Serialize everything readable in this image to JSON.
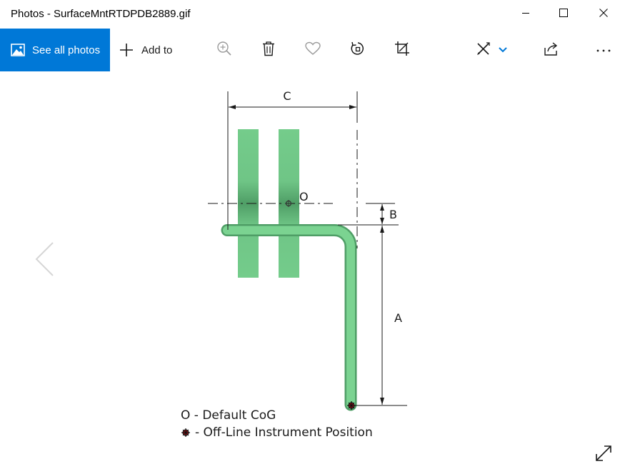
{
  "window": {
    "title": "Photos - SurfaceMntRTDPDB2889.gif",
    "controls": {
      "minimize_icon": "minimize-icon",
      "maximize_icon": "maximize-icon",
      "close_icon": "close-icon"
    }
  },
  "toolbar": {
    "see_all_label": "See all photos",
    "add_to_label": "Add to",
    "icons": [
      "zoom-in-icon",
      "delete-icon",
      "favorite-icon",
      "rotate-icon",
      "crop-icon",
      "edit-icon",
      "share-icon",
      "more-icon"
    ],
    "accent_color": "#0078d7"
  },
  "diagram": {
    "labels": {
      "c": "C",
      "b": "B",
      "a": "A",
      "o": "O"
    },
    "legend": {
      "default_cog": "O - Default CoG",
      "instrument_position": "- Off-Line Instrument Position"
    },
    "colors": {
      "pipe": "#74cc8b",
      "pipe_dark": "#4fa86a",
      "marker": "#d8141c"
    }
  }
}
